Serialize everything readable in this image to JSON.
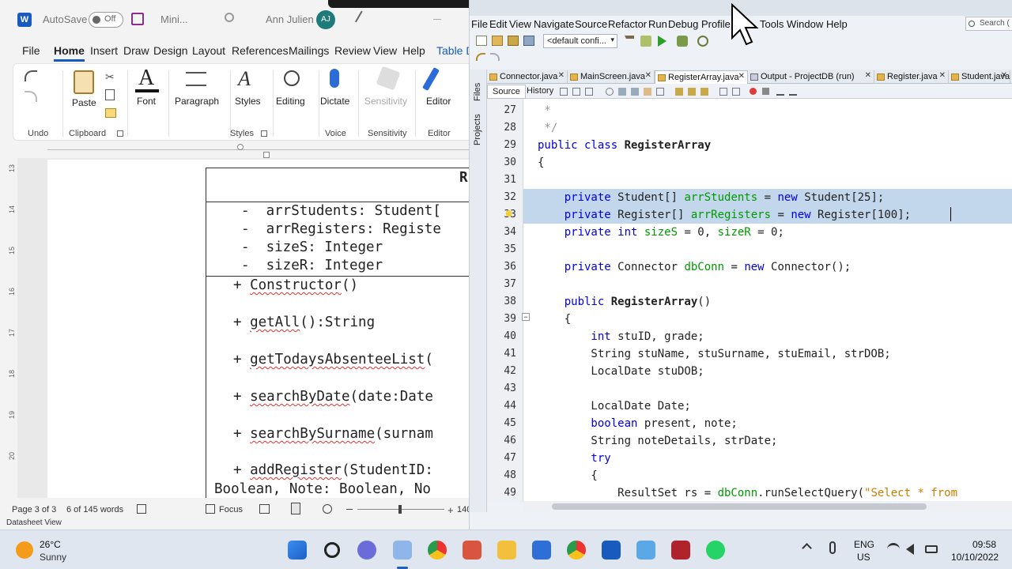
{
  "word": {
    "autosave_label": "AutoSave",
    "autosave_state": "Off",
    "doc_name": "Mini...",
    "user_name": "Ann Julien",
    "user_initials": "AJ",
    "menu": [
      "File",
      "Home",
      "Insert",
      "Draw",
      "Design",
      "Layout",
      "References",
      "Mailings",
      "Review",
      "View",
      "Help",
      "Table D"
    ],
    "ribbon": {
      "undo_group": "Undo",
      "paste": "Paste",
      "clipboard_group": "Clipboard",
      "font": "Font",
      "paragraph": "Paragraph",
      "styles": "Styles",
      "styles_group": "Styles",
      "editing": "Editing",
      "dictate": "Dictate",
      "voice_group": "Voice",
      "sensitivity": "Sensitivity",
      "sensitivity_group": "Sensitivity",
      "editor": "Editor",
      "editor_group": "Editor"
    },
    "vruler": [
      "13",
      "14",
      "15",
      "16",
      "17",
      "18",
      "19",
      "20"
    ],
    "uml": {
      "title_fragment": "R",
      "attributes": [
        "-  arrStudents: Student[",
        "-  arrRegisters: Registe",
        "-  sizeS: Integer",
        "-  sizeR: Integer"
      ],
      "methods": [
        {
          "prefix": "+ ",
          "name": "Constructor",
          "rest": "()"
        },
        {
          "prefix": "+ ",
          "name": "getAll",
          "rest": "():String"
        },
        {
          "prefix": "+ ",
          "name": "getTodaysAbsenteeList",
          "rest": "("
        },
        {
          "prefix": "+ ",
          "name": "searchByDate",
          "rest": "(date:Date"
        },
        {
          "prefix": "+ ",
          "name": "searchBySurname",
          "rest": "(surnam"
        },
        {
          "prefix": "+ ",
          "name": "addRegister",
          "rest": "(StudentID:"
        }
      ],
      "cut_line": "Boolean, Note: Boolean, No"
    },
    "status": {
      "page": "Page 3 of 3",
      "words": "6 of 145 words",
      "focus": "Focus",
      "zoom_fragment": "140"
    },
    "datasheet_view": "Datasheet View"
  },
  "netbeans": {
    "menu": [
      "File",
      "Edit",
      "View",
      "Navigate",
      "Source",
      "Refactor",
      "Run",
      "Debug",
      "Profile",
      "Tools",
      "Window",
      "Help"
    ],
    "search_placeholder": "Search (",
    "config_select": "<default confi...",
    "side_tabs": [
      "Files",
      "Projects"
    ],
    "tabs": [
      "Connector.java",
      "MainScreen.java",
      "RegisterArray.java",
      "Output - ProjectDB (run)",
      "Register.java",
      "Student.java"
    ],
    "active_tab": "RegisterArray.java",
    "source_tab": "Source",
    "history_tab": "History",
    "code_lines": [
      {
        "n": "27",
        "parts": [
          {
            "t": " *",
            "c": "cmt"
          }
        ]
      },
      {
        "n": "28",
        "parts": [
          {
            "t": " */",
            "c": "cmt"
          }
        ]
      },
      {
        "n": "29",
        "parts": [
          {
            "t": "public class ",
            "c": "kw"
          },
          {
            "t": "RegisterArray",
            "c": "b"
          }
        ]
      },
      {
        "n": "30",
        "parts": [
          {
            "t": "{",
            "c": ""
          }
        ]
      },
      {
        "n": "31",
        "parts": [
          {
            "t": "",
            "c": ""
          }
        ]
      },
      {
        "n": "32",
        "sel": true,
        "parts": [
          {
            "t": "    private ",
            "c": "kw"
          },
          {
            "t": "Student[] ",
            "c": ""
          },
          {
            "t": "arrStudents",
            "c": "fld"
          },
          {
            "t": " = ",
            "c": ""
          },
          {
            "t": "new ",
            "c": "kw"
          },
          {
            "t": "Student[25];",
            "c": ""
          }
        ]
      },
      {
        "n": "33",
        "sel": true,
        "parts": [
          {
            "t": "    private ",
            "c": "kw"
          },
          {
            "t": "Register[] ",
            "c": ""
          },
          {
            "t": "arrRegisters",
            "c": "fld"
          },
          {
            "t": " = ",
            "c": ""
          },
          {
            "t": "new ",
            "c": "kw"
          },
          {
            "t": "Register[100];",
            "c": ""
          }
        ]
      },
      {
        "n": "34",
        "parts": [
          {
            "t": "    private int ",
            "c": "kw"
          },
          {
            "t": "sizeS",
            "c": "fld"
          },
          {
            "t": " = 0, ",
            "c": ""
          },
          {
            "t": "sizeR",
            "c": "fld"
          },
          {
            "t": " = 0;",
            "c": ""
          }
        ]
      },
      {
        "n": "35",
        "parts": [
          {
            "t": "",
            "c": ""
          }
        ]
      },
      {
        "n": "36",
        "parts": [
          {
            "t": "    private ",
            "c": "kw"
          },
          {
            "t": "Connector ",
            "c": ""
          },
          {
            "t": "dbConn",
            "c": "fld"
          },
          {
            "t": " = ",
            "c": ""
          },
          {
            "t": "new ",
            "c": "kw"
          },
          {
            "t": "Connector();",
            "c": ""
          }
        ]
      },
      {
        "n": "37",
        "parts": [
          {
            "t": "",
            "c": ""
          }
        ]
      },
      {
        "n": "38",
        "parts": [
          {
            "t": "    public ",
            "c": "kw"
          },
          {
            "t": "RegisterArray",
            "c": "b"
          },
          {
            "t": "()",
            "c": ""
          }
        ]
      },
      {
        "n": "39",
        "parts": [
          {
            "t": "    {",
            "c": ""
          }
        ]
      },
      {
        "n": "40",
        "parts": [
          {
            "t": "        int ",
            "c": "kw"
          },
          {
            "t": "stuID, grade;",
            "c": ""
          }
        ]
      },
      {
        "n": "41",
        "parts": [
          {
            "t": "        String stuName, stuSurname, stuEmail, strDOB;",
            "c": ""
          }
        ]
      },
      {
        "n": "42",
        "parts": [
          {
            "t": "        LocalDate stuDOB;",
            "c": ""
          }
        ]
      },
      {
        "n": "43",
        "parts": [
          {
            "t": "",
            "c": ""
          }
        ]
      },
      {
        "n": "44",
        "parts": [
          {
            "t": "        LocalDate Date;",
            "c": ""
          }
        ]
      },
      {
        "n": "45",
        "parts": [
          {
            "t": "        boolean ",
            "c": "kw"
          },
          {
            "t": "present, note;",
            "c": ""
          }
        ]
      },
      {
        "n": "46",
        "parts": [
          {
            "t": "        String noteDetails, strDate;",
            "c": ""
          }
        ]
      },
      {
        "n": "47",
        "parts": [
          {
            "t": "        try",
            "c": "kw"
          }
        ]
      },
      {
        "n": "48",
        "parts": [
          {
            "t": "        {",
            "c": ""
          }
        ]
      },
      {
        "n": "49",
        "parts": [
          {
            "t": "            ResultSet rs = ",
            "c": ""
          },
          {
            "t": "dbConn",
            "c": "fld"
          },
          {
            "t": ".runSelectQuery(",
            "c": ""
          },
          {
            "t": "\"Select * from",
            "c": "str"
          }
        ]
      }
    ]
  },
  "taskbar": {
    "weather_temp": "26°C",
    "weather_desc": "Sunny",
    "lang_line1": "ENG",
    "lang_line2": "US",
    "time": "09:58",
    "date": "10/10/2022"
  }
}
